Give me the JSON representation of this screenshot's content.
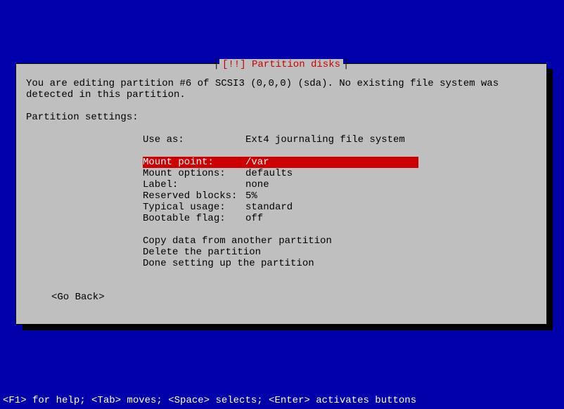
{
  "dialog": {
    "title": "[!!] Partition disks",
    "description": "You are editing partition #6 of SCSI3 (0,0,0) (sda). No existing file system was detected in this partition.",
    "section_label": "Partition settings:",
    "rows": [
      {
        "key": "Use as:",
        "value": "Ext4 journaling file system",
        "selected": false
      },
      {
        "spacer": true
      },
      {
        "key": "Mount point:",
        "value": "/var",
        "selected": true
      },
      {
        "key": "Mount options:",
        "value": "defaults",
        "selected": false
      },
      {
        "key": "Label:",
        "value": "none",
        "selected": false
      },
      {
        "key": "Reserved blocks:",
        "value": "5%",
        "selected": false
      },
      {
        "key": "Typical usage:",
        "value": "standard",
        "selected": false
      },
      {
        "key": "Bootable flag:",
        "value": "off",
        "selected": false
      },
      {
        "spacer": true
      },
      {
        "key": "Copy data from another partition",
        "value": "",
        "selected": false
      },
      {
        "key": "Delete the partition",
        "value": "",
        "selected": false
      },
      {
        "key": "Done setting up the partition",
        "value": "",
        "selected": false
      }
    ],
    "go_back": "<Go Back>"
  },
  "status_bar": "<F1> for help; <Tab> moves; <Space> selects; <Enter> activates buttons"
}
